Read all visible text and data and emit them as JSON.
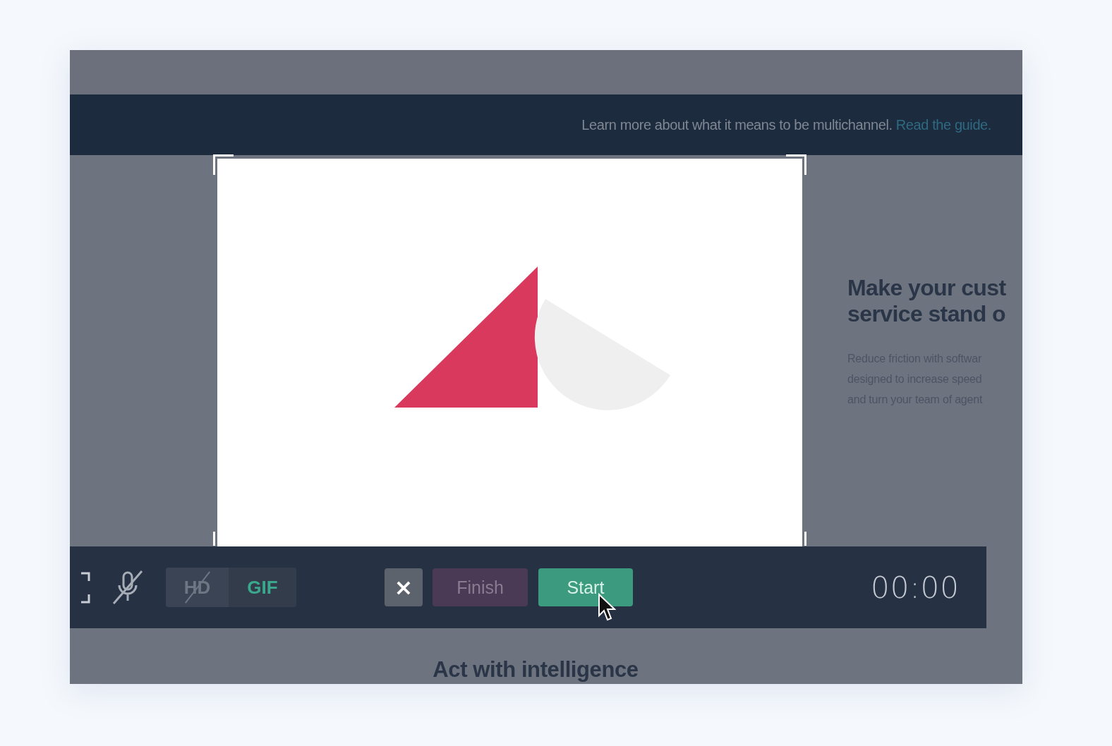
{
  "banner": {
    "text": "Learn more about what it means to be multichannel.",
    "link": "Read the guide."
  },
  "page": {
    "heading_lines": [
      "Make your cust",
      "service stand o"
    ],
    "body_lines": [
      "Reduce friction with softwar",
      "designed to increase speed",
      "and turn your team of agent"
    ],
    "section_heading": "Act with intelligence"
  },
  "toolbar": {
    "microphone": {
      "muted": true
    },
    "formats": [
      {
        "label": "HD",
        "selected": false,
        "disabled": true
      },
      {
        "label": "GIF",
        "selected": true,
        "disabled": false
      }
    ],
    "cancel": "×",
    "finish": {
      "label": "Finish",
      "disabled": true
    },
    "start": {
      "label": "Start"
    },
    "timer": "00:00"
  }
}
